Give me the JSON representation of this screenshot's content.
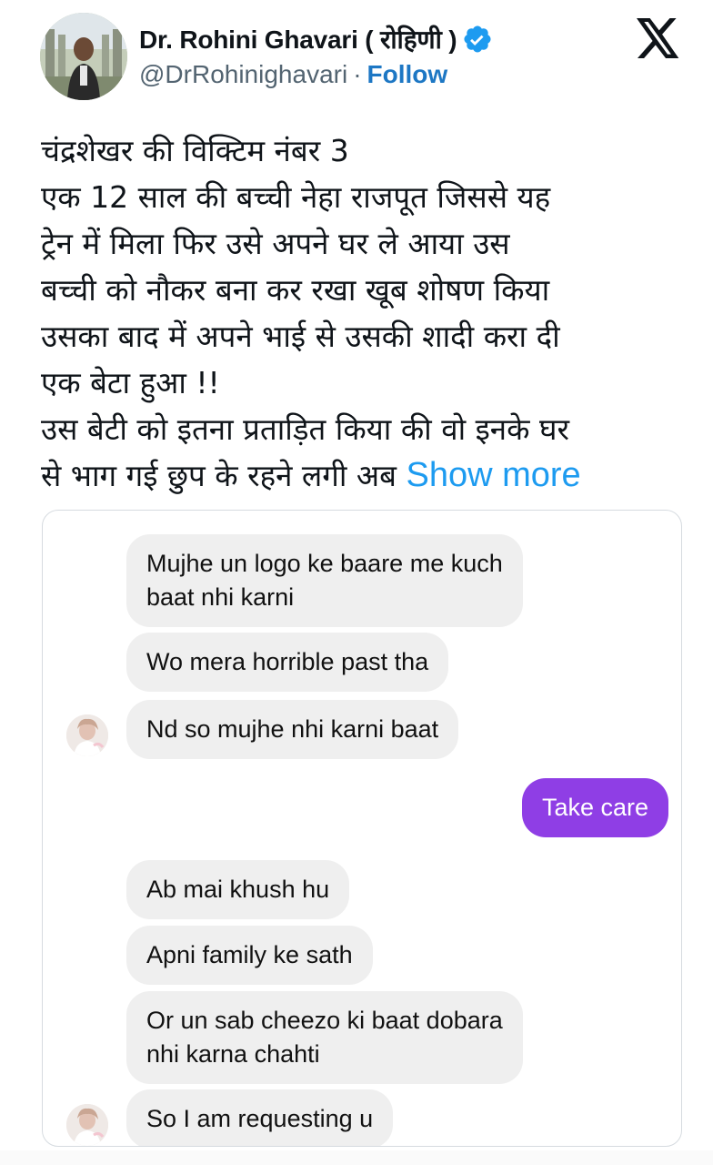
{
  "author": {
    "display_name": "Dr. Rohini Ghavari ( रोहिणी )",
    "handle": "@DrRohinighavari",
    "separator": "·",
    "follow_label": "Follow",
    "verified_icon": "verified-badge-icon",
    "verified_color": "#1d9bf0"
  },
  "platform": {
    "logo_icon": "x-logo-icon"
  },
  "tweet": {
    "lines": [
      "चंद्रशेखर की विक्टिम नंबर 3",
      "एक 12 साल की बच्ची नेहा राजपूत जिससे यह",
      "ट्रेन में मिला फिर उसे अपने घर ले आया उस",
      "बच्ची को नौकर बना कर रखा खूब शोषण किया",
      "उसका बाद में अपने भाई से उसकी शादी करा दी",
      "एक बेटा हुआ !!",
      "उस बेटी को इतना प्रताड़ित किया की वो इनके घर"
    ],
    "last_line": "से भाग गई छुप के रहने लगी अब",
    "show_more": "Show more",
    "link_color": "#1d9bf0"
  },
  "chat": {
    "messages": [
      {
        "from": "them",
        "lines": [
          "Mujhe un logo ke baare me kuch",
          "baat nhi karni"
        ]
      },
      {
        "from": "them",
        "lines": [
          "Wo mera horrible past tha"
        ]
      },
      {
        "from": "them",
        "lines": [
          "Nd so mujhe nhi karni baat"
        ]
      },
      {
        "from": "me",
        "lines": [
          "Take care"
        ]
      },
      {
        "from": "them",
        "lines": [
          "Ab mai khush hu"
        ]
      },
      {
        "from": "them",
        "lines": [
          "Apni family ke sath"
        ]
      },
      {
        "from": "them",
        "lines": [
          "Or un sab cheezo ki baat dobara",
          "nhi karna chahti"
        ]
      },
      {
        "from": "them",
        "lines": [
          "So I am requesting u"
        ]
      }
    ],
    "sent_color": "#8f3ee5",
    "received_color": "#efefef"
  }
}
